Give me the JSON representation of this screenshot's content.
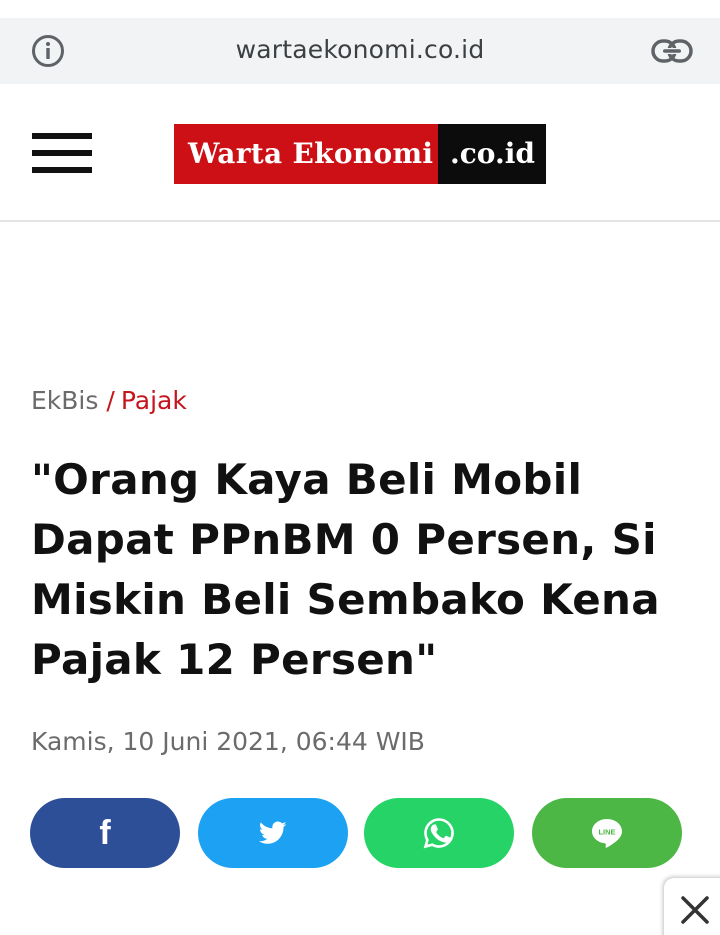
{
  "browser": {
    "url": "wartaekonomi.co.id",
    "info_icon": "info-circle-icon",
    "link_icon": "link-icon"
  },
  "header": {
    "menu_icon": "hamburger-menu-icon",
    "logo": {
      "part1": "Warta Ekonomi",
      "part2": ".co.id",
      "colors": {
        "primary": "#cc1016",
        "secondary": "#0c0c0c"
      }
    }
  },
  "article": {
    "breadcrumb": {
      "section": "EkBis",
      "separator": "/",
      "category": "Pajak"
    },
    "title": "\"Orang Kaya Beli Mobil Dapat PPnBM 0 Persen, Si Miskin Beli Sembako Kena Pajak 12 Persen\"",
    "date": "Kamis, 10 Juni 2021, 06:44 WIB"
  },
  "share": {
    "buttons": [
      {
        "network": "facebook",
        "icon": "facebook-icon",
        "glyph": "f",
        "color": "#2d4f98"
      },
      {
        "network": "twitter",
        "icon": "twitter-icon",
        "color": "#1da1f2"
      },
      {
        "network": "whatsapp",
        "icon": "whatsapp-icon",
        "color": "#25d366"
      },
      {
        "network": "line",
        "icon": "line-icon",
        "label": "LINE",
        "color": "#4cb744"
      }
    ]
  },
  "ad": {
    "close_icon": "close-icon"
  }
}
